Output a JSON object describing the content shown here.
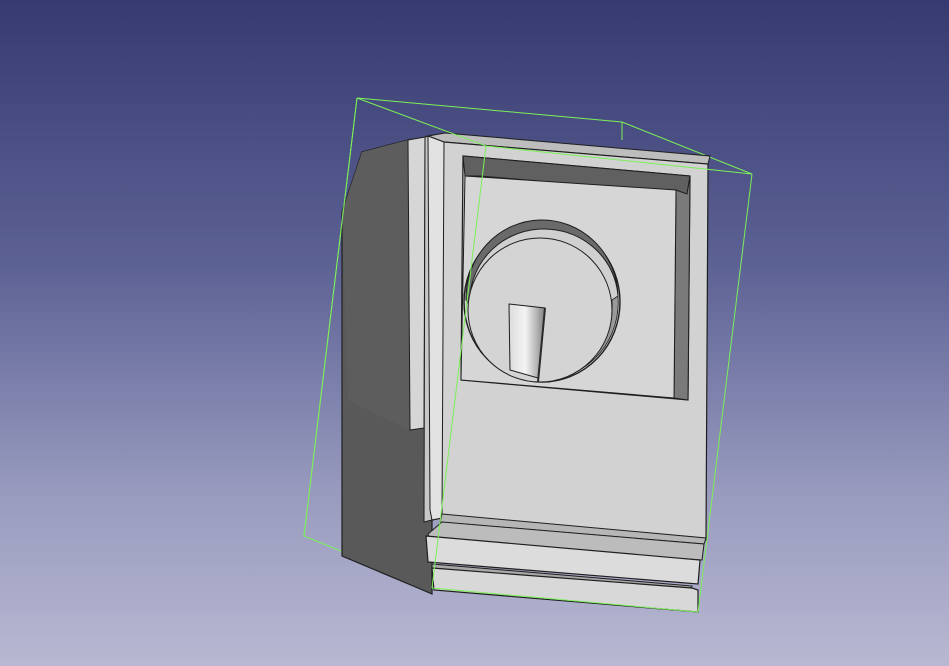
{
  "viewport": {
    "background_top": "#363a70",
    "background_bottom": "#b8b8d2",
    "selection_box_color": "#7cf05a"
  },
  "model": {
    "face_color": "#d2d2d2",
    "side_color": "#595959",
    "edge_color": "#1e1e1e"
  }
}
